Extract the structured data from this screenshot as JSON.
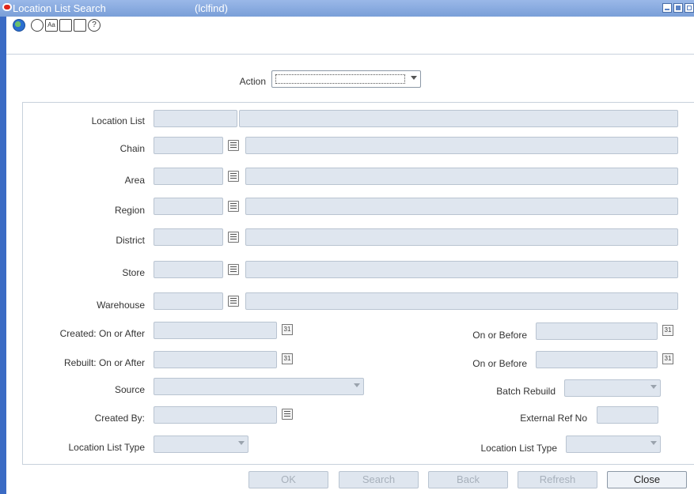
{
  "window": {
    "title": "Location List Search",
    "code": "(lclfind)"
  },
  "toolbar": {
    "icons": [
      "globe-icon",
      "help-tip-icon",
      "text-icon",
      "calendar-icon",
      "notes-icon",
      "help-icon"
    ]
  },
  "action": {
    "label": "Action",
    "value": ""
  },
  "fields": {
    "location_list": "Location List",
    "chain": "Chain",
    "area": "Area",
    "region": "Region",
    "district": "District",
    "store": "Store",
    "warehouse": "Warehouse",
    "created_after": "Created: On or After",
    "rebuilt_after": "Rebuilt: On or After",
    "source": "Source",
    "created_by": "Created By:",
    "location_list_type": "Location List Type",
    "on_or_before": "On or Before",
    "batch_rebuild": "Batch Rebuild",
    "external_ref_no": "External Ref No",
    "location_list_type_right": "Location List Type"
  },
  "buttons": {
    "ok": "OK",
    "search": "Search",
    "back": "Back",
    "refresh": "Refresh",
    "close": "Close"
  },
  "colors": {
    "titlebar": "#7a9fd8",
    "field": "#dfe6ef",
    "border": "#b9c4d1"
  }
}
